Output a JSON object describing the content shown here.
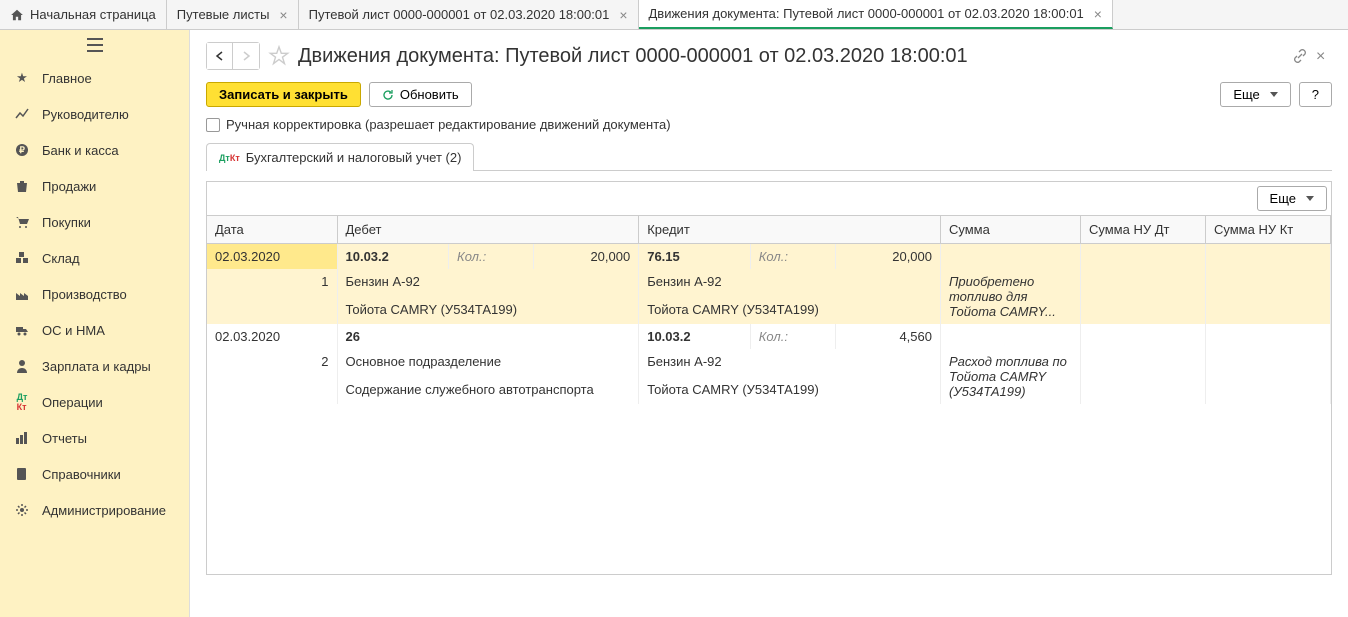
{
  "tabs": [
    {
      "label": "Начальная страница",
      "closable": false
    },
    {
      "label": "Путевые листы",
      "closable": true
    },
    {
      "label": "Путевой лист 0000-000001 от 02.03.2020 18:00:01",
      "closable": true
    },
    {
      "label": "Движения документа: Путевой лист 0000-000001 от 02.03.2020 18:00:01",
      "closable": true,
      "active": true
    }
  ],
  "sidebar": {
    "items": [
      {
        "label": "Главное"
      },
      {
        "label": "Руководителю"
      },
      {
        "label": "Банк и касса"
      },
      {
        "label": "Продажи"
      },
      {
        "label": "Покупки"
      },
      {
        "label": "Склад"
      },
      {
        "label": "Производство"
      },
      {
        "label": "ОС и НМА"
      },
      {
        "label": "Зарплата и кадры"
      },
      {
        "label": "Операции"
      },
      {
        "label": "Отчеты"
      },
      {
        "label": "Справочники"
      },
      {
        "label": "Администрирование"
      }
    ]
  },
  "page": {
    "title": "Движения документа: Путевой лист 0000-000001 от 02.03.2020 18:00:01",
    "save_close": "Записать и закрыть",
    "refresh": "Обновить",
    "more": "Еще",
    "help": "?",
    "manual_check": "Ручная корректировка (разрешает редактирование движений документа)",
    "inner_tab": "Бухгалтерский и налоговый учет (2)"
  },
  "table": {
    "headers": {
      "date": "Дата",
      "debit": "Дебет",
      "credit": "Кредит",
      "sum": "Сумма",
      "nu_dt": "Сумма НУ Дт",
      "nu_kt": "Сумма НУ Кт"
    },
    "qty_label": "Кол.:",
    "more": "Еще",
    "rows": [
      {
        "n": "1",
        "date": "02.03.2020",
        "deb_acc": "10.03.2",
        "deb_qty": "20,000",
        "deb_l1": "Бензин А-92",
        "deb_l2": "Тойота CAMRY (У534ТА199)",
        "cred_acc": "76.15",
        "cred_qty": "20,000",
        "cred_l1": "Бензин А-92",
        "cred_l2": "Тойота CAMRY (У534ТА199)",
        "sum_note": "Приобретено топливо для Тойота CAMRY..."
      },
      {
        "n": "2",
        "date": "02.03.2020",
        "deb_acc": "26",
        "deb_l1": "Основное подразделение",
        "deb_l2": "Содержание служебного автотранспорта",
        "cred_acc": "10.03.2",
        "cred_qty": "4,560",
        "cred_l1": "Бензин А-92",
        "cred_l2": "Тойота CAMRY (У534ТА199)",
        "sum_note": "Расход топлива по Тойота CAMRY (У534ТА199)"
      }
    ]
  }
}
